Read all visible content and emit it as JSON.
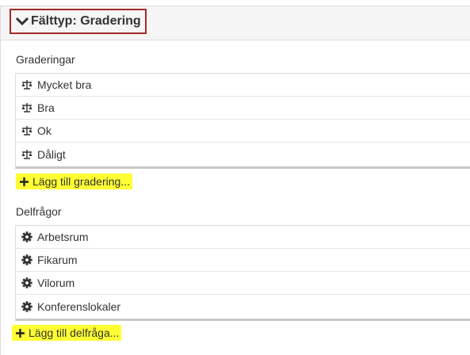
{
  "header": {
    "title": "Fälttyp: Gradering",
    "icon": "chevron-down-icon"
  },
  "gradings": {
    "label": "Graderingar",
    "icon": "balance-scale-icon",
    "items": [
      {
        "label": "Mycket bra"
      },
      {
        "label": "Bra"
      },
      {
        "label": "Ok"
      },
      {
        "label": "Dåligt"
      }
    ],
    "add_label": "Lägg till gradering..."
  },
  "subquestions": {
    "label": "Delfrågor",
    "icon": "gear-icon",
    "items": [
      {
        "label": "Arbetsrum"
      },
      {
        "label": "Fikarum"
      },
      {
        "label": "Vilorum"
      },
      {
        "label": "Konferenslokaler"
      }
    ],
    "add_label": "Lägg till delfråga..."
  },
  "colors": {
    "highlight": "#ffff33",
    "title_border": "#a52a2a",
    "header_bg": "#f5f5f5"
  }
}
